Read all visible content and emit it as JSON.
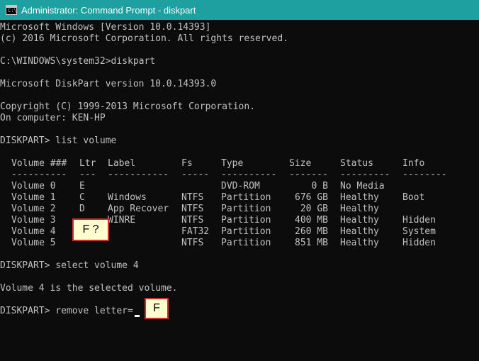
{
  "window": {
    "title": "Administrator: Command Prompt - diskpart",
    "icon": "cmd-icon",
    "icon_prompt": "C:\\",
    "titlebar_color": "#1e9fa0",
    "console_bg": "#0c0c0c",
    "console_fg": "#c0c0c0"
  },
  "console": {
    "header_lines": [
      "Microsoft Windows [Version 10.0.14393]",
      "(c) 2016 Microsoft Corporation. All rights reserved.",
      "",
      "C:\\WINDOWS\\system32>diskpart",
      "",
      "Microsoft DiskPart version 10.0.14393.0",
      "",
      "Copyright (C) 1999-2013 Microsoft Corporation.",
      "On computer: KEN-HP",
      "",
      "DISKPART> list volume",
      ""
    ],
    "table": {
      "headers": [
        "Volume ###",
        "Ltr",
        "Label",
        "Fs",
        "Type",
        "Size",
        "Status",
        "Info"
      ],
      "separators": [
        "----------",
        "---",
        "-----------",
        "-----",
        "----------",
        "-------",
        "---------",
        "--------"
      ],
      "rows": [
        [
          "Volume 0",
          "E",
          "",
          "",
          "DVD-ROM",
          "0 B",
          "No Media",
          ""
        ],
        [
          "Volume 1",
          "C",
          "Windows",
          "NTFS",
          "Partition",
          "676 GB",
          "Healthy",
          "Boot"
        ],
        [
          "Volume 2",
          "D",
          "App Recover",
          "NTFS",
          "Partition",
          "20 GB",
          "Healthy",
          ""
        ],
        [
          "Volume 3",
          "",
          "WINRE",
          "NTFS",
          "Partition",
          "400 MB",
          "Healthy",
          "Hidden"
        ],
        [
          "Volume 4",
          "",
          "",
          "FAT32",
          "Partition",
          "260 MB",
          "Healthy",
          "System"
        ],
        [
          "Volume 5",
          "",
          "",
          "NTFS",
          "Partition",
          "851 MB",
          "Healthy",
          "Hidden"
        ]
      ]
    },
    "footer_lines": [
      "",
      "DISKPART> select volume 4",
      "",
      "Volume 4 is the selected volume.",
      "",
      "DISKPART> remove letter="
    ]
  },
  "annotations": {
    "callout_ltr": "F ?",
    "callout_input": "F",
    "callout_bg": "#fffdd0",
    "callout_border": "#c8302c"
  }
}
